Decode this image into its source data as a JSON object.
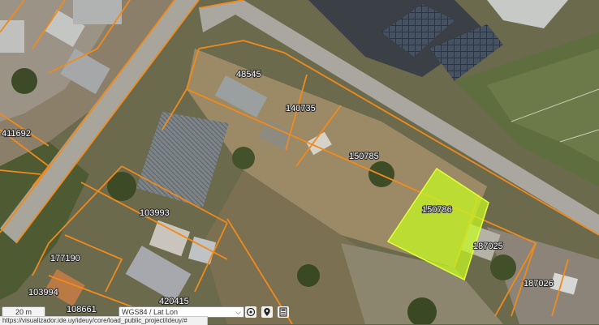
{
  "parcels": [
    {
      "id": "48545"
    },
    {
      "id": "140735"
    },
    {
      "id": "150785"
    },
    {
      "id": "150786"
    },
    {
      "id": "187025"
    },
    {
      "id": "187026"
    },
    {
      "id": "411692"
    },
    {
      "id": "103993"
    },
    {
      "id": "177190"
    },
    {
      "id": "103994"
    },
    {
      "id": "108661"
    },
    {
      "id": "420415"
    }
  ],
  "selected_parcel": "150786",
  "colors": {
    "lot_outline": "#f08a1c",
    "selection_fill": "#c8ff1e",
    "selection_outline": "#e3ff3a"
  },
  "toolbar": {
    "scale_text": "20 m",
    "projection_value": "WGS84 / Lat Lon",
    "locate_icon": "crosshair-icon",
    "pin_icon": "map-pin-icon",
    "calc_icon": "calculator-icon"
  },
  "statusbar": {
    "url": "https://visualizador.ide.uy/ideuy/core/load_public_project/ideuy/#"
  }
}
